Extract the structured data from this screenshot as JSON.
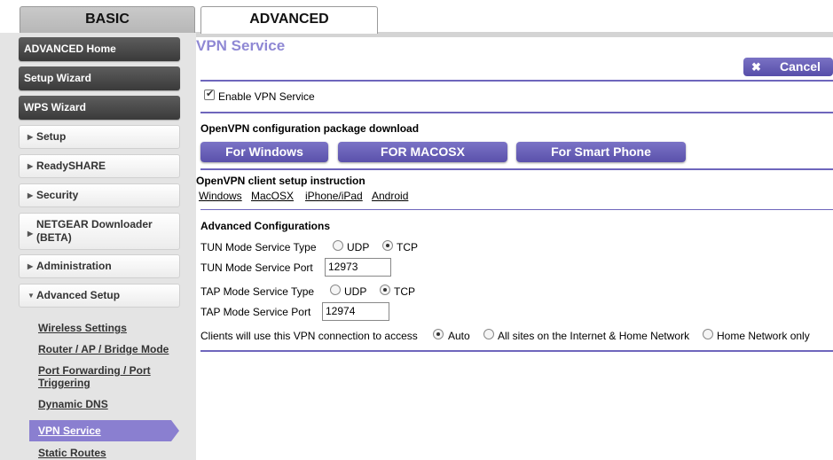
{
  "tabs": {
    "basic": "BASIC",
    "advanced": "ADVANCED"
  },
  "sidebar": {
    "dark_items": [
      "ADVANCED Home",
      "Setup Wizard",
      "WPS Wizard"
    ],
    "light_items": [
      "Setup",
      "ReadySHARE",
      "Security",
      "NETGEAR Downloader (BETA)",
      "Administration",
      "Advanced Setup"
    ],
    "sub_items": [
      "Wireless Settings",
      "Router / AP / Bridge Mode",
      "Port Forwarding / Port Triggering",
      "Dynamic DNS",
      "VPN Service",
      "Static Routes"
    ],
    "active_sub": "VPN Service"
  },
  "main": {
    "title": "VPN Service",
    "cancel": {
      "icon": "close-icon",
      "label": "Cancel"
    },
    "enable_vpn": {
      "label": "Enable VPN Service",
      "checked": true
    },
    "download_heading": "OpenVPN configuration package download",
    "download_buttons": [
      "For Windows",
      "FOR MACOSX",
      "For Smart Phone"
    ],
    "instruction_heading": "OpenVPN client setup instruction",
    "instruction_links": [
      "Windows",
      "MacOSX",
      "iPhone/iPad",
      "Android"
    ],
    "advanced_heading": "Advanced Configurations",
    "tun_type_label": "TUN Mode Service Type",
    "tun_port_label": "TUN Mode Service Port",
    "tun_port": "12973",
    "tap_type_label": "TAP Mode Service Type",
    "tap_port_label": "TAP Mode Service Port",
    "tap_port": "12974",
    "protocol_options": [
      "UDP",
      "TCP"
    ],
    "tun_selected": "TCP",
    "tap_selected": "TCP",
    "access_label": "Clients will use this VPN connection to access",
    "access_options": [
      "Auto",
      "All sites on the Internet & Home Network",
      "Home Network only"
    ],
    "access_selected": "Auto"
  },
  "colors": {
    "accent": "#6e66bc",
    "title": "#8f88d4",
    "active_nav": "#8a7fd0"
  }
}
